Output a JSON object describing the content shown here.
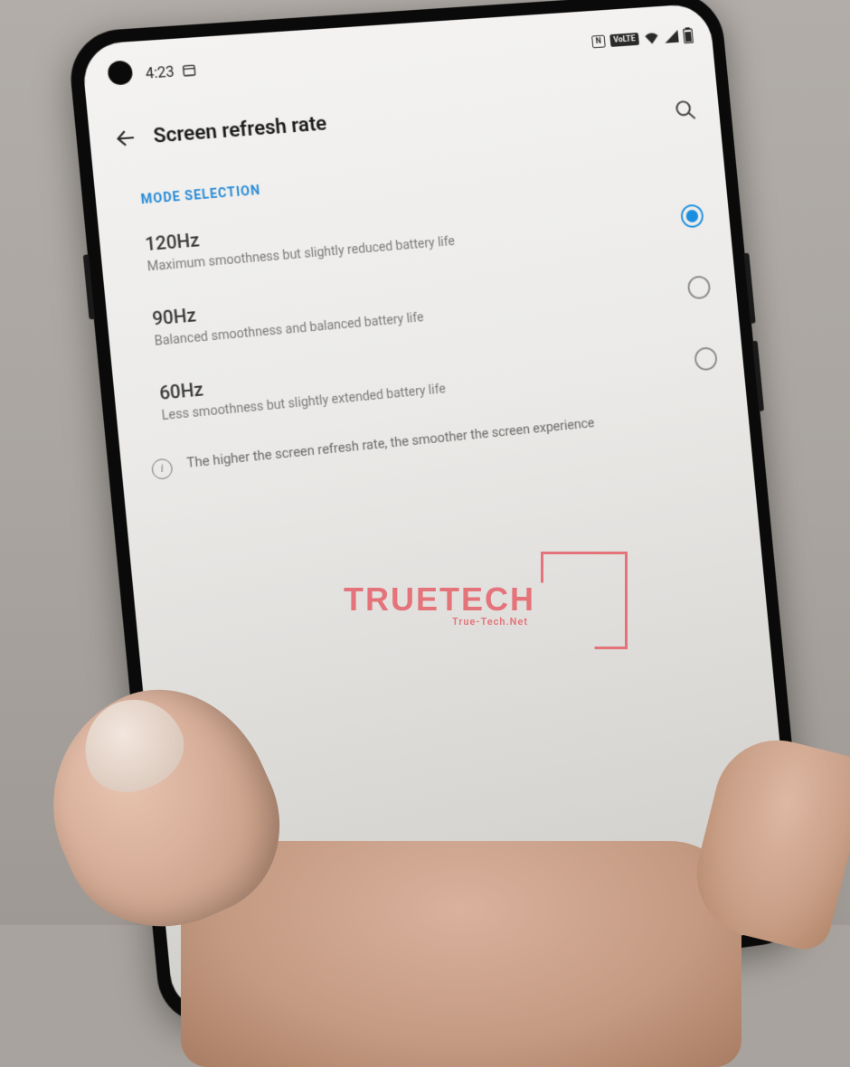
{
  "status_bar": {
    "time": "4:23",
    "nfc_label": "N",
    "volte_label": "VoLTE"
  },
  "header": {
    "title": "Screen refresh rate"
  },
  "section": {
    "label": "MODE SELECTION"
  },
  "options": [
    {
      "title": "120Hz",
      "subtitle": "Maximum smoothness but slightly reduced battery life",
      "selected": true
    },
    {
      "title": "90Hz",
      "subtitle": "Balanced smoothness and balanced battery life",
      "selected": false
    },
    {
      "title": "60Hz",
      "subtitle": "Less smoothness but slightly extended battery life",
      "selected": false
    }
  ],
  "info": {
    "text": "The higher the screen refresh rate, the smoother the screen experience"
  },
  "watermark": {
    "brand": "TRUETECH",
    "url": "True-Tech.Net"
  }
}
